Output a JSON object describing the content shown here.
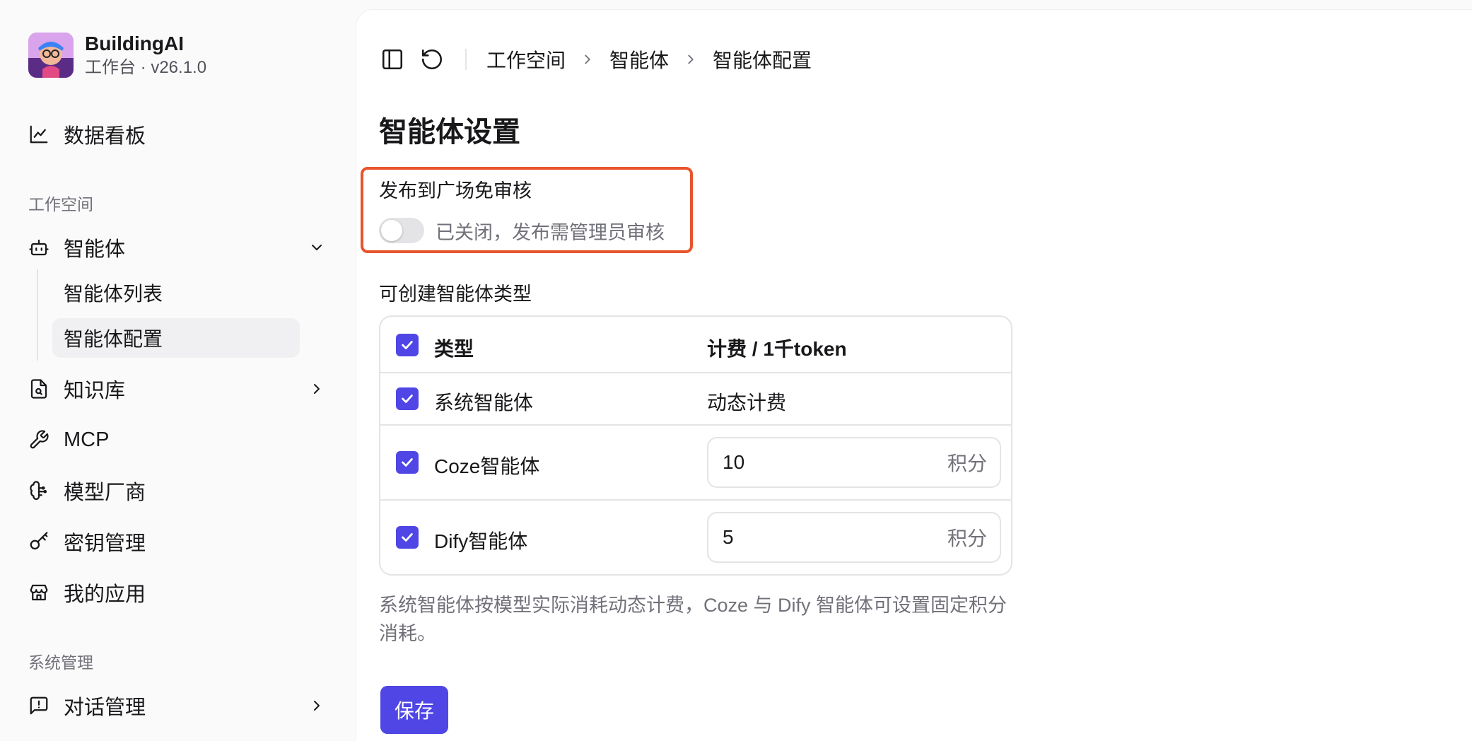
{
  "brand": {
    "name": "BuildingAI",
    "subtitle": "工作台 · v26.1.0"
  },
  "sidebar": {
    "dashboard": "数据看板",
    "section_workspace": "工作空间",
    "agents": {
      "label": "智能体",
      "children": [
        "智能体列表",
        "智能体配置"
      ],
      "active_child": "智能体配置"
    },
    "knowledge": "知识库",
    "mcp": "MCP",
    "model_vendor": "模型厂商",
    "key_management": "密钥管理",
    "my_apps": "我的应用",
    "section_system": "系统管理",
    "chat_management": "对话管理"
  },
  "breadcrumb": [
    "工作空间",
    "智能体",
    "智能体配置"
  ],
  "page_title": "智能体设置",
  "publish_review": {
    "label": "发布到广场免审核",
    "enabled": false,
    "status_text": "已关闭，发布需管理员审核"
  },
  "agent_types": {
    "label": "可创建智能体类型",
    "header": {
      "col1": "类型",
      "col2": "计费 / 1千token"
    },
    "rows": [
      {
        "name": "系统智能体",
        "billing": "动态计费",
        "checked": true
      },
      {
        "name": "Coze智能体",
        "value": "10",
        "unit": "积分",
        "checked": true
      },
      {
        "name": "Dify智能体",
        "value": "5",
        "unit": "积分",
        "checked": true
      }
    ],
    "hint": "系统智能体按模型实际消耗动态计费，Coze 与 Dify 智能体可设置固定积分消耗。"
  },
  "save_label": "保存",
  "colors": {
    "accent": "#4f46e5",
    "highlight": "#e8542c"
  }
}
